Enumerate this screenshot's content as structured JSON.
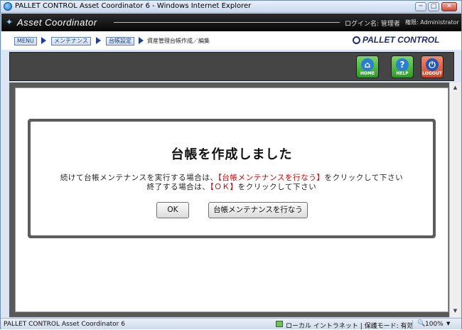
{
  "window": {
    "title": "PALLET CONTROL Asset Coordinator 6 - Windows Internet Explorer",
    "minimize": "─",
    "maximize": "□",
    "close": "✕"
  },
  "header": {
    "app_name": "Asset Coordinator",
    "login_label": "ログイン名: 管理者",
    "role_label": "権限: Administrator"
  },
  "breadcrumb": {
    "items": [
      "MENU",
      "メンテナンス",
      "台帳設定"
    ],
    "current": "資産管理台帳作成／編集",
    "brand": "PALLET CONTROL"
  },
  "toolbar": {
    "home_label": "HOME",
    "help_label": "HELP",
    "logout_label": "LOGOUT",
    "home_glyph": "⌂",
    "help_glyph": "?",
    "logout_glyph": "⏻"
  },
  "dialog": {
    "title": "台帳を作成しました",
    "line1_pre": "続けて台帳メンテナンスを実行する場合は、",
    "line1_highlight": "【台帳メンテナンスを行なう】",
    "line1_post": "をクリックして下さい",
    "line2_pre": "終了する場合は、",
    "line2_highlight": "【ＯＫ】",
    "line2_post": "をクリックして下さい",
    "ok_button": "OK",
    "maintenance_button": "台帳メンテナンスを行なう"
  },
  "status": {
    "left": "PALLET CONTROL Asset Coordinator 6",
    "zone": "ローカル イントラネット | 保護モード: 有効",
    "zoom": "100%"
  },
  "colors": {
    "highlight": "#cc0000",
    "appbar": "#050505",
    "toolbar": "#454545"
  }
}
